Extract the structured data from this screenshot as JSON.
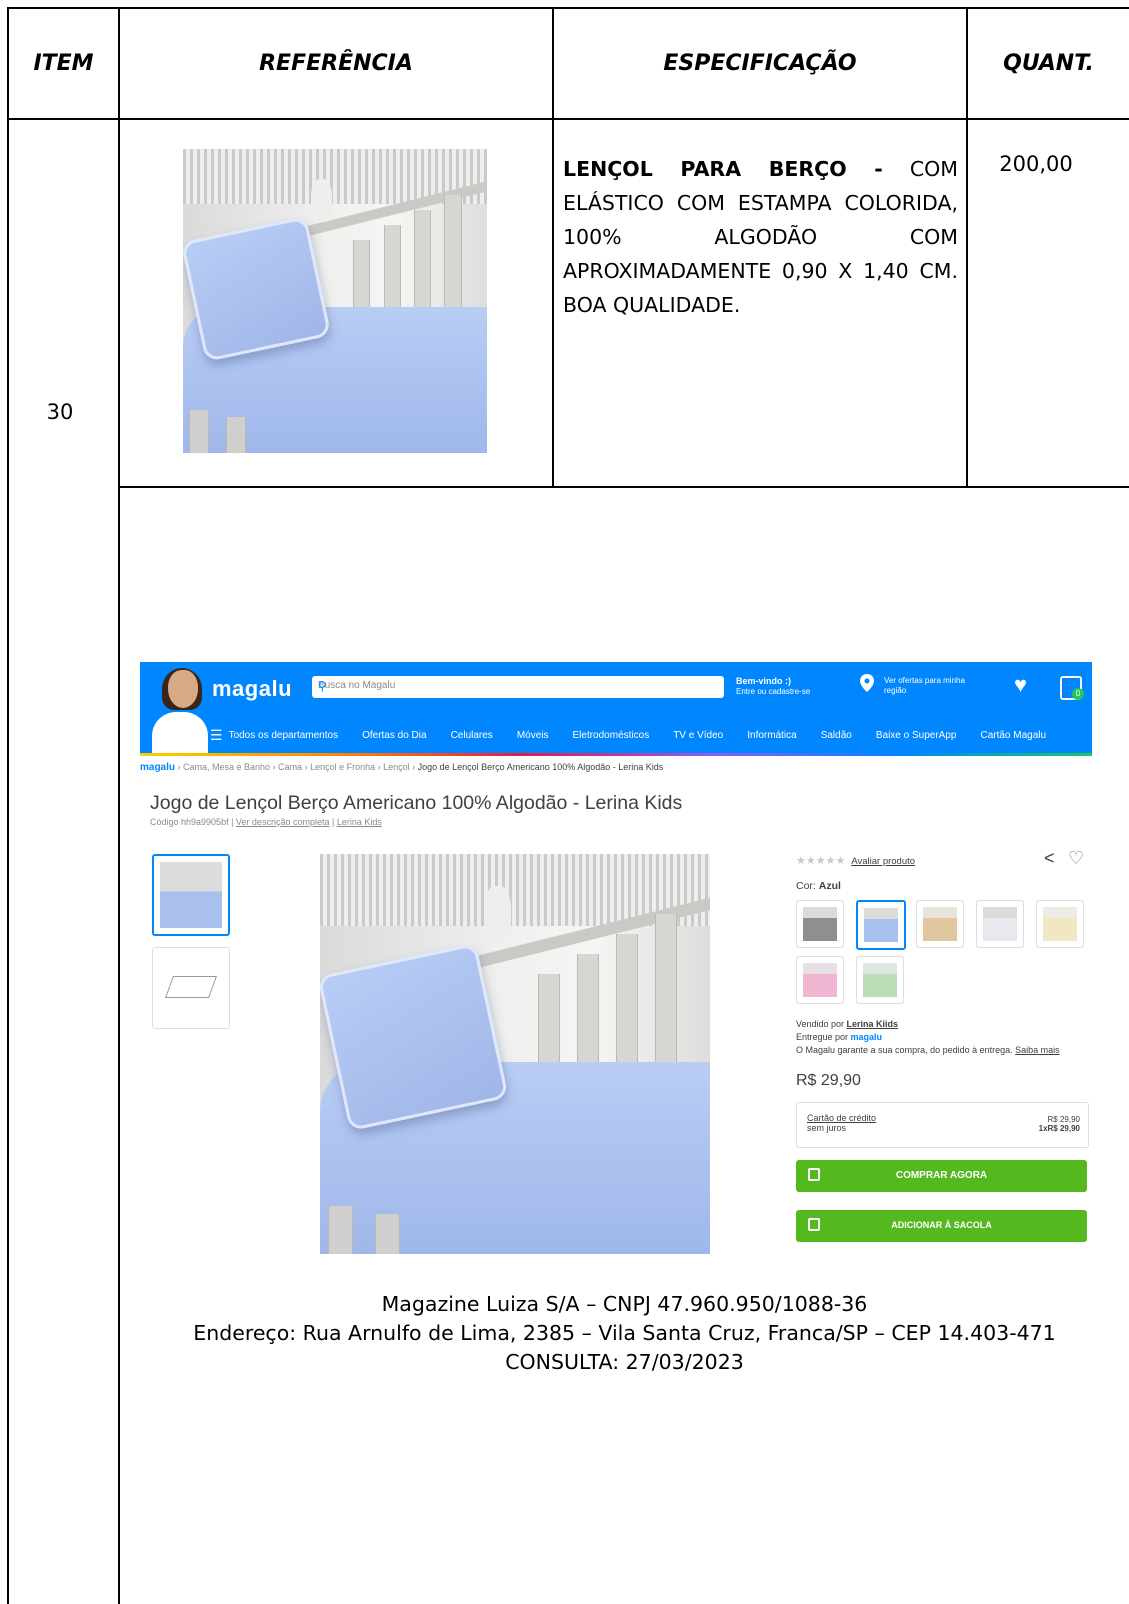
{
  "table": {
    "headers": {
      "item": "ITEM",
      "referencia": "REFERÊNCIA",
      "especificacao": "ESPECIFICAÇÃO",
      "quant": "QUANT."
    },
    "row": {
      "item": "30",
      "spec_title": "LENÇOL PARA BERÇO -",
      "spec_text": " COM ELÁSTICO COM ESTAMPA COLORIDA, 100% ALGODÃO COM APROXIMADAMENTE 0,90 X 1,40 CM. BOA QUALIDADE.",
      "quantity": "200,00"
    }
  },
  "screenshot": {
    "logo": "magalu",
    "search_placeholder": "Busca no Magalu",
    "welcome_title": "Bem-vindo :)",
    "welcome_sub": "Entre ou cadastre-se",
    "location_line1": "Ver ofertas para minha",
    "location_line2": "região",
    "cart_count": "0",
    "nav": [
      "Todos os departamentos",
      "Ofertas do Dia",
      "Celulares",
      "Móveis",
      "Eletrodomésticos",
      "TV e Vídeo",
      "Informática",
      "Saldão",
      "Baixe o SuperApp",
      "Cartão Magalu"
    ],
    "breadcrumb_logo": "magalu",
    "breadcrumb": " › Cama, Mesa e Banho › Cama › Lençol e Fronha › Lençol › ",
    "breadcrumb_current": "Jogo de Lençol Berço Americano 100% Algodão - Lerina Kids",
    "title": "Jogo de Lençol Berço Americano 100% Algodão - Lerina Kids",
    "code_prefix": "Código hh9a9905bf | ",
    "code_link1": "Ver descrição completa",
    "code_sep": " | ",
    "code_link2": "Lerina Kids",
    "stars": "★★★★★",
    "rate_link": "Avaliar produto",
    "color_label": "Cor: ",
    "color_value": "Azul",
    "sold_by_label": "Vendido por ",
    "sold_by": "Lerina Kiids",
    "delivered_by_label": "Entregue por ",
    "delivered_by": "magalu",
    "guarantee": "O Magalu garante a sua compra, do pedido à entrega. ",
    "guarantee_link": "Saiba mais",
    "price": "R$ 29,90",
    "card_label": "Cartão de crédito",
    "card_sub": "sem juros",
    "card_price": "R$ 29,90",
    "card_install": "1xR$ 29,90",
    "buy_now": "COMPRAR AGORA",
    "add_bag": "ADICIONAR À SACOLA",
    "swatch_colors": [
      "#8e8f90",
      "#a8c0ee",
      "#e0c79f",
      "#e8e9ee",
      "#f1e7c4",
      "#f1b7d2",
      "#b9ddb4"
    ],
    "accent": "#0086ff",
    "button_color": "#54b81f"
  },
  "caption": {
    "line1": "Magazine Luiza S/A – CNPJ 47.960.950/1088-36",
    "line2": "Endereço: Rua Arnulfo de Lima, 2385 – Vila Santa Cruz, Franca/SP – CEP 14.403-471",
    "line3": "CONSULTA: 27/03/2023"
  }
}
